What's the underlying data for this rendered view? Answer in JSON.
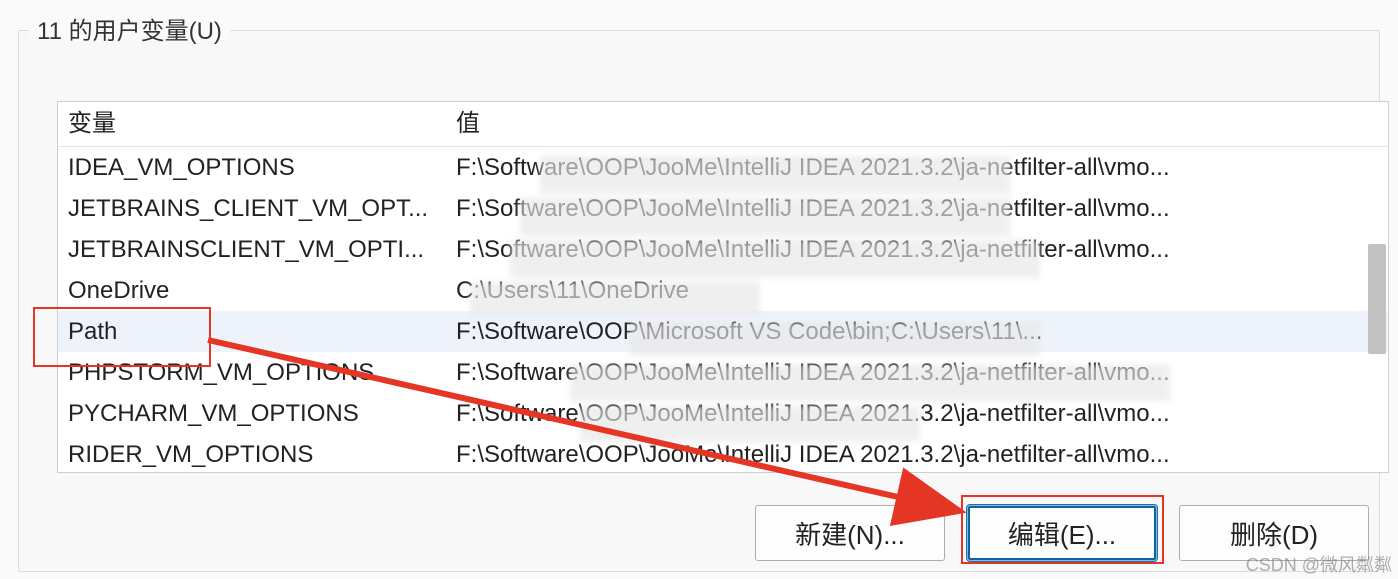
{
  "group_title": "11 的用户变量(U)",
  "columns": {
    "name": "变量",
    "value": "值"
  },
  "rows": [
    {
      "name": "IDEA_VM_OPTIONS",
      "value": "F:\\Software\\OOP\\JooMe\\IntelliJ IDEA 2021.3.2\\ja-netfilter-all\\vmo..."
    },
    {
      "name": "JETBRAINS_CLIENT_VM_OPT...",
      "value": "F:\\Software\\OOP\\JooMe\\IntelliJ IDEA 2021.3.2\\ja-netfilter-all\\vmo..."
    },
    {
      "name": "JETBRAINSCLIENT_VM_OPTI...",
      "value": "F:\\Software\\OOP\\JooMe\\IntelliJ IDEA 2021.3.2\\ja-netfilter-all\\vmo..."
    },
    {
      "name": "OneDrive",
      "value": "C:\\Users\\11\\OneDrive"
    },
    {
      "name": "Path",
      "value": "F:\\Software\\OOP\\Microsoft VS Code\\bin;C:\\Users\\11\\...",
      "selected": true
    },
    {
      "name": "PHPSTORM_VM_OPTIONS",
      "value": "F:\\Software\\OOP\\JooMe\\IntelliJ IDEA 2021.3.2\\ja-netfilter-all\\vmo..."
    },
    {
      "name": "PYCHARM_VM_OPTIONS",
      "value": "F:\\Software\\OOP\\JooMe\\IntelliJ IDEA 2021.3.2\\ja-netfilter-all\\vmo..."
    },
    {
      "name": "RIDER_VM_OPTIONS",
      "value": "F:\\Software\\OOP\\JooMe\\IntelliJ IDEA 2021.3.2\\ja-netfilter-all\\vmo..."
    }
  ],
  "buttons": {
    "new": "新建(N)...",
    "edit": "编辑(E)...",
    "delete": "删除(D)"
  },
  "watermark": "CSDN @微风粼粼"
}
